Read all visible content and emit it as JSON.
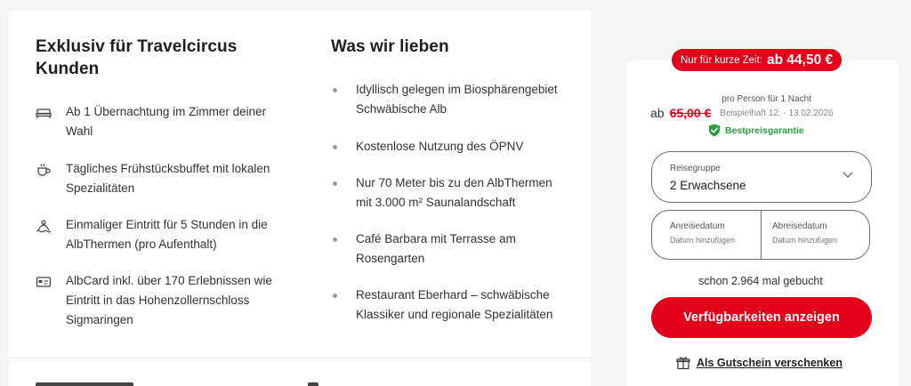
{
  "highlights": {
    "title": "Exklusiv für Travelcircus Kunden",
    "items": [
      {
        "icon": "bed-icon",
        "text": "Ab 1 Übernachtung im Zimmer deiner Wahl"
      },
      {
        "icon": "coffee-cup-icon",
        "text": "Tägliches Frühstücksbuffet mit lokalen Spezialitäten"
      },
      {
        "icon": "spa-entry-icon",
        "text": "Einmaliger Eintritt für 5 Stunden in die AlbThermen (pro Aufenthalt)"
      },
      {
        "icon": "card-icon",
        "text": "AlbCard inkl. über 170 Erlebnissen wie Eintritt in das Hohenzollernschloss Sigmaringen"
      }
    ]
  },
  "love": {
    "title": "Was wir lieben",
    "items": [
      "Idyllisch gelegen im Biosphärengebiet Schwäbische Alb",
      "Kostenlose Nutzung des ÖPNV",
      "Nur 70 Meter bis zu den AlbThermen mit 3.000 m² Saunalandschaft",
      "Café Barbara mit Terrasse am Rosengarten",
      "Restaurant Eberhard – schwäbische Klassiker und regionale Spezialitäten"
    ]
  },
  "booking": {
    "promo_label": "Nur für kurze Zeit:",
    "promo_price": "ab 44,50 €",
    "price_prefix": "ab",
    "old_price": "65,00 €",
    "per_person": "pro Person für 1 Nacht",
    "example_dates": "Beispielhaft 12. - 13.02.2026",
    "best_price": "Bestpreisgarantie",
    "guests_label": "Reisegruppe",
    "guests_value": "2 Erwachsene",
    "arrival_label": "Anreisedatum",
    "arrival_placeholder": "Datum hinzufügen",
    "departure_label": "Abreisedatum",
    "departure_placeholder": "Datum hinzufügen",
    "booked_count": "schon 2.964 mal gebucht",
    "cta_label": "Verfügbarkeiten anzeigen",
    "gift_label": "Als Gutschein verschenken"
  },
  "colors": {
    "accent": "#e3001b",
    "success": "#2b9e40"
  }
}
